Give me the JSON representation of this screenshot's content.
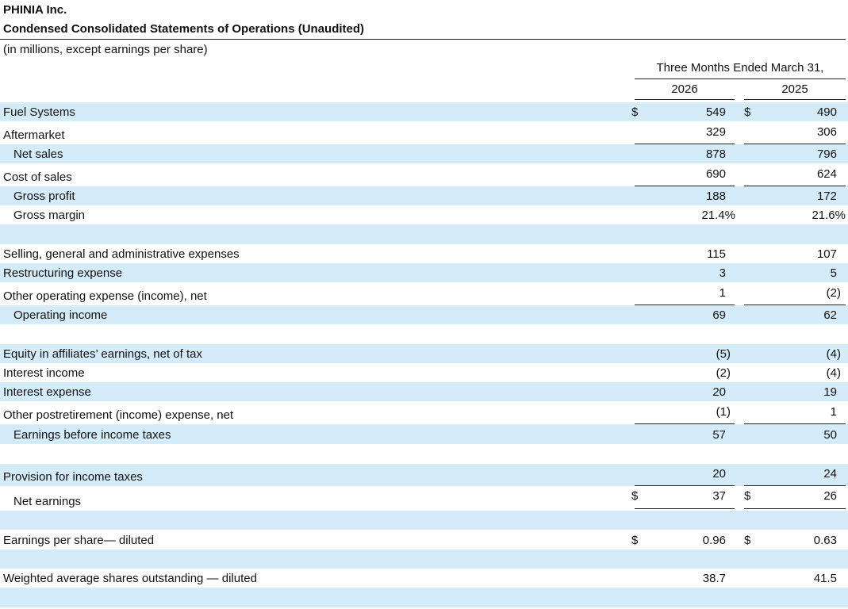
{
  "header": {
    "company": "PHINIA Inc.",
    "title": "Condensed Consolidated Statements of Operations (Unaudited)",
    "subtitle": "(in millions, except earnings per share)",
    "period": "Three Months Ended March 31,",
    "year1": "2026",
    "year2": "2025"
  },
  "rows": [
    {
      "label": "Fuel Systems",
      "d1": "$",
      "v1": "549",
      "d2": "$",
      "v2": "490"
    },
    {
      "label": "Aftermarket",
      "v1": "329",
      "v2": "306"
    },
    {
      "label": "Net sales",
      "v1": "878",
      "v2": "796"
    },
    {
      "label": "Cost of sales",
      "v1": "690",
      "v2": "624"
    },
    {
      "label": "Gross profit",
      "v1": "188",
      "v2": "172"
    },
    {
      "label": "Gross margin",
      "v1": "21.4%",
      "v2": "21.6%"
    },
    {
      "label": "",
      "v1": "",
      "v2": ""
    },
    {
      "label": "Selling, general and administrative expenses",
      "v1": "115",
      "v2": "107"
    },
    {
      "label": "Restructuring expense",
      "v1": "3",
      "v2": "5"
    },
    {
      "label": "Other operating expense (income), net",
      "v1": "1",
      "v2": "(2)"
    },
    {
      "label": "Operating income",
      "v1": "69",
      "v2": "62"
    },
    {
      "label": "",
      "v1": "",
      "v2": ""
    },
    {
      "label": "Equity in affiliates’ earnings, net of tax",
      "v1": "(5)",
      "v2": "(4)"
    },
    {
      "label": "Interest income",
      "v1": "(2)",
      "v2": "(4)"
    },
    {
      "label": "Interest expense",
      "v1": "20",
      "v2": "19"
    },
    {
      "label": "Other postretirement (income) expense, net",
      "v1": "(1)",
      "v2": "1"
    },
    {
      "label": "Earnings before income taxes",
      "v1": "57",
      "v2": "50"
    },
    {
      "label": "",
      "v1": "",
      "v2": ""
    },
    {
      "label": "Provision for income taxes",
      "v1": "20",
      "v2": "24"
    },
    {
      "label": "Net earnings",
      "d1": "$",
      "v1": "37",
      "d2": "$",
      "v2": "26"
    },
    {
      "label": "",
      "v1": "",
      "v2": ""
    },
    {
      "label": "Earnings per share— diluted",
      "d1": "$",
      "v1": "0.96",
      "d2": "$",
      "v2": "0.63"
    },
    {
      "label": "",
      "v1": "",
      "v2": ""
    },
    {
      "label": "Weighted average shares outstanding — diluted",
      "v1": "38.7",
      "v2": "41.5"
    },
    {
      "label": "",
      "v1": "",
      "v2": ""
    }
  ]
}
